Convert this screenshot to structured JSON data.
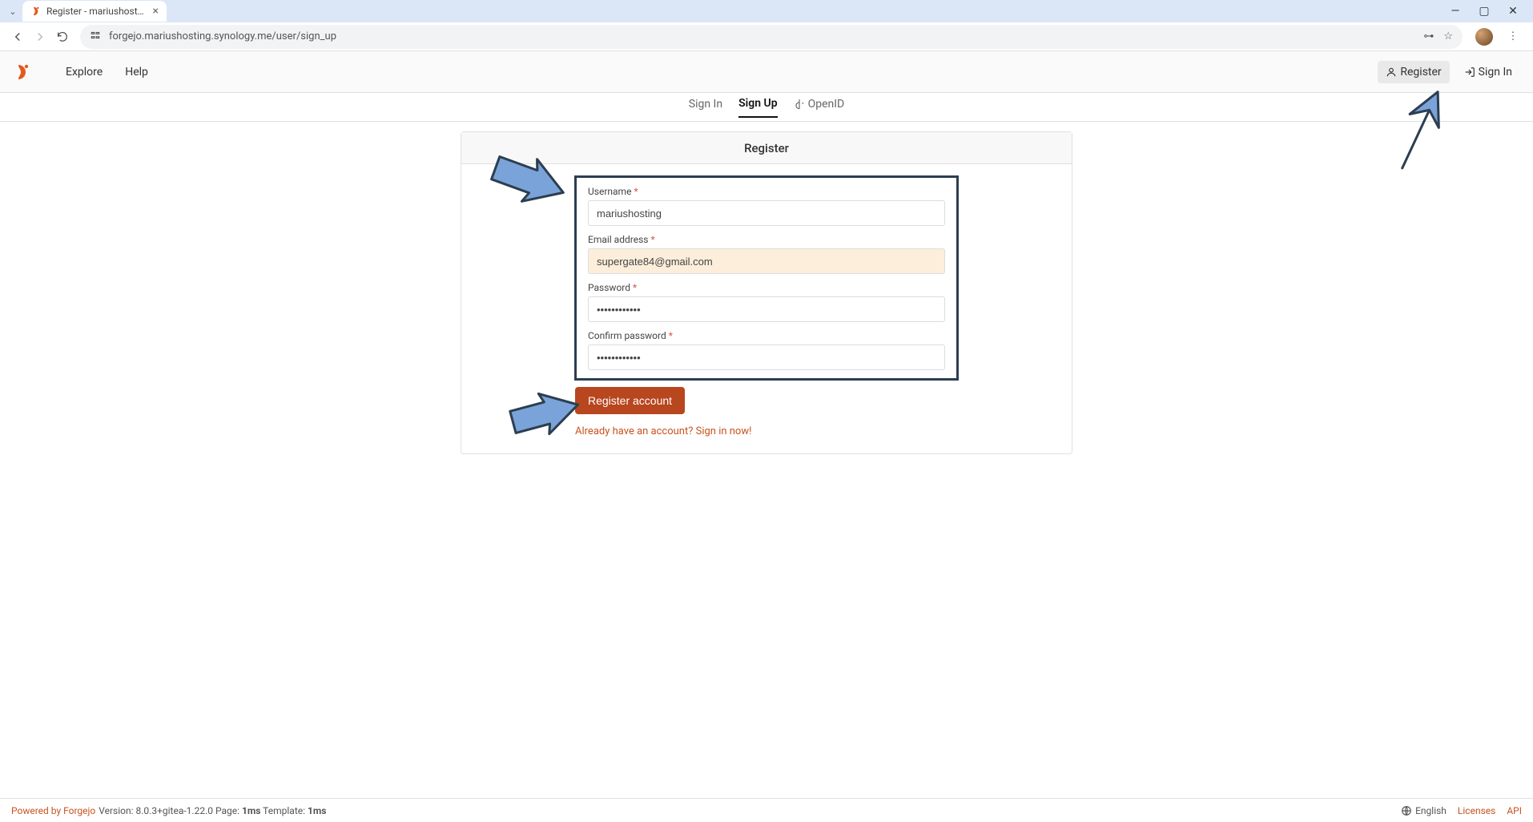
{
  "browser": {
    "tab_title": "Register - mariushosting: Beyon",
    "url": "forgejo.mariushosting.synology.me/user/sign_up"
  },
  "nav": {
    "explore": "Explore",
    "help": "Help",
    "register": "Register",
    "signin": "Sign In"
  },
  "subtabs": {
    "signin": "Sign In",
    "signup": "Sign Up",
    "openid": "OpenID"
  },
  "panel": {
    "title": "Register",
    "fields": {
      "username_label": "Username",
      "username_value": "mariushosting",
      "email_label": "Email address",
      "email_value": "supergate84@gmail.com",
      "password_label": "Password",
      "password_value": "••••••••••••",
      "confirm_label": "Confirm password",
      "confirm_value": "••••••••••••"
    },
    "submit": "Register account",
    "already": "Already have an account? Sign in now!"
  },
  "footer": {
    "powered": "Powered by Forgejo",
    "version_prefix": " Version: 8.0.3+gitea-1.22.0 Page: ",
    "page_time": "1ms",
    "template_prefix": " Template: ",
    "template_time": "1ms",
    "lang": "English",
    "licenses": "Licenses",
    "api": "API"
  }
}
